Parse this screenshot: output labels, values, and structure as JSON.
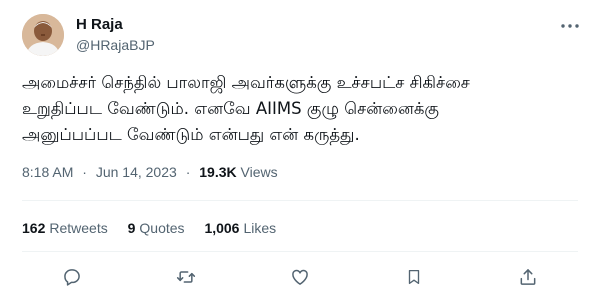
{
  "author": {
    "display_name": "H Raja",
    "handle": "@HRajaBJP",
    "avatar_icon": "user-avatar"
  },
  "tweet": {
    "lines": [
      "அமைச்சர் செந்தில் பாலாஜி அவர்களுக்கு உச்சபட்ச சிகிச்சை",
      "உறுதிப்பட வேண்டும். எனவே AIIMS குழு சென்னைக்கு",
      "அனுப்பப்பட வேண்டும் என்பது என் கருத்து."
    ]
  },
  "meta": {
    "time": "8:18 AM",
    "separator1": "·",
    "date": "Jun 14, 2023",
    "separator2": "·",
    "views_count": "19.3K",
    "views_label": "Views"
  },
  "stats": {
    "retweets_count": "162",
    "retweets_label": "Retweets",
    "quotes_count": "9",
    "quotes_label": "Quotes",
    "likes_count": "1,006",
    "likes_label": "Likes"
  },
  "actions": [
    "reply-icon",
    "retweet-icon",
    "like-icon",
    "bookmark-icon",
    "share-icon"
  ],
  "colors": {
    "text_primary": "#0f1419",
    "text_secondary": "#536471",
    "divider": "#eff3f4"
  }
}
